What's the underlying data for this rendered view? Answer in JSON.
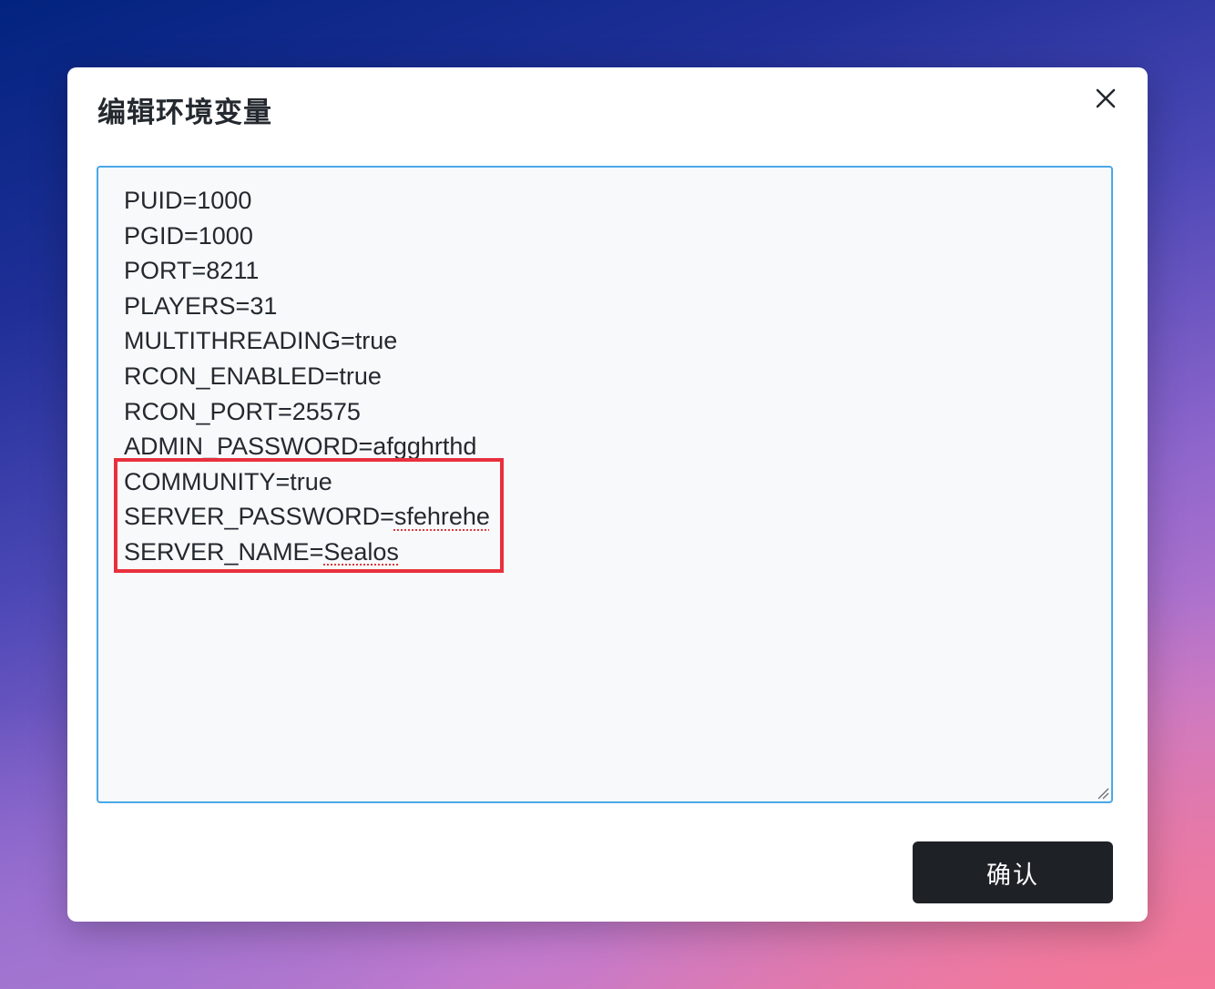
{
  "dialog": {
    "title": "编辑环境变量",
    "close_icon": "close-icon",
    "confirm_label": "确认"
  },
  "editor": {
    "lines": [
      {
        "text": "PUID=1000"
      },
      {
        "text": "PGID=1000"
      },
      {
        "text": "PORT=8211"
      },
      {
        "text": "PLAYERS=31"
      },
      {
        "text": "MULTITHREADING=true"
      },
      {
        "text": "RCON_ENABLED=true"
      },
      {
        "text": "RCON_PORT=25575"
      },
      {
        "key": "ADMIN_PASSWORD=",
        "value": "afgghrthd"
      },
      {
        "text": "COMMUNITY=true"
      },
      {
        "key": "SERVER_PASSWORD=",
        "value": "sfehrehe"
      },
      {
        "key": "SERVER_NAME=",
        "value": "Sealos"
      }
    ],
    "highlight_color": "#e8303d",
    "border_color": "#4aa8e8"
  },
  "colors": {
    "button_bg": "#1e2227",
    "text": "#24292f"
  }
}
